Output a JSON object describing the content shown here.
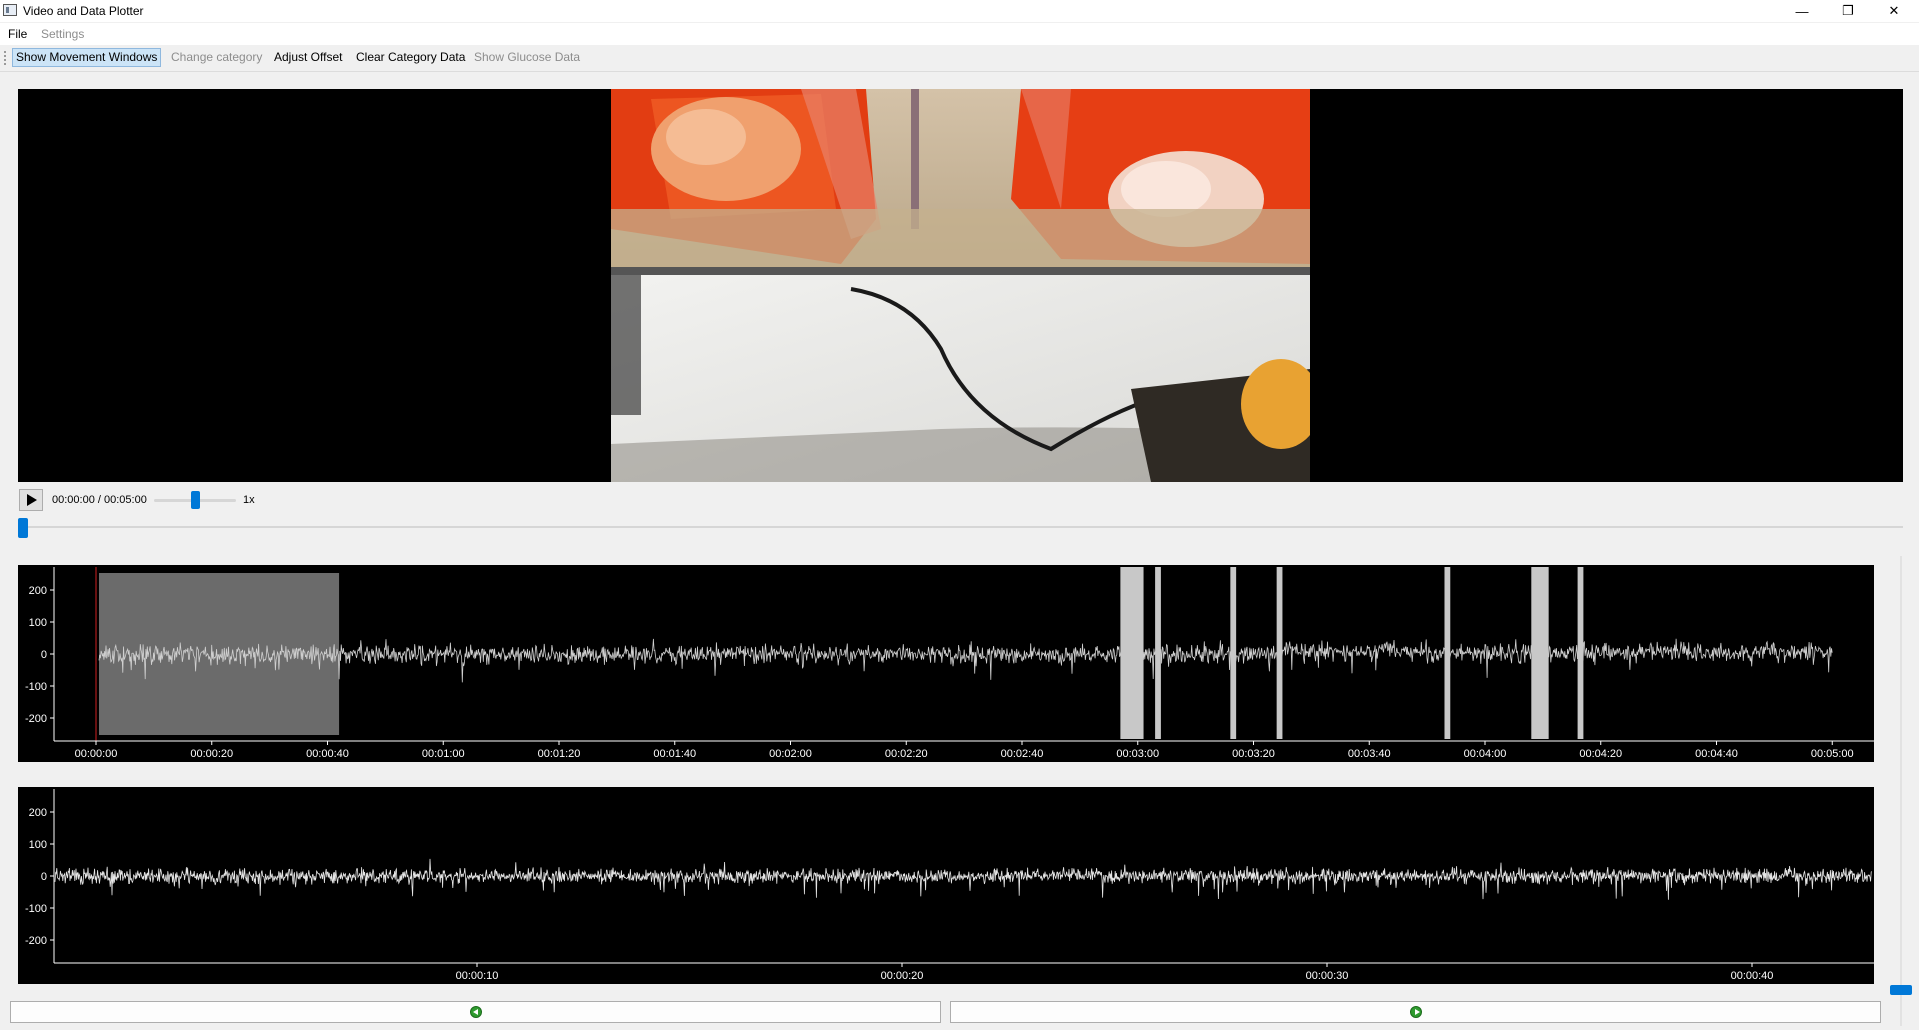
{
  "window": {
    "title": "Video and Data Plotter",
    "minimize": "—",
    "maximize": "❐",
    "close": "✕"
  },
  "menu": {
    "items": [
      {
        "label": "File",
        "enabled": true
      },
      {
        "label": "Settings",
        "enabled": false
      }
    ]
  },
  "toolbar": {
    "buttons": [
      {
        "label": "Show Movement Windows",
        "state": "checked"
      },
      {
        "label": "Change category",
        "state": "disabled"
      },
      {
        "label": "Adjust Offset",
        "state": "enabled"
      },
      {
        "label": "Clear Category Data",
        "state": "enabled"
      },
      {
        "label": "Show Glucose Data",
        "state": "disabled"
      }
    ]
  },
  "player": {
    "time": "00:00:00 / 00:05:00",
    "speed": "1x",
    "speed_level": 0.5,
    "seek_position": 0.0,
    "play_icon": "play-icon"
  },
  "plots": {
    "overview": {
      "y_ticks": [
        "200",
        "100",
        "0",
        "-100",
        "-200"
      ],
      "x_ticks": [
        "00:00:00",
        "00:00:20",
        "00:00:40",
        "00:01:00",
        "00:01:20",
        "00:01:40",
        "00:02:00",
        "00:02:20",
        "00:02:40",
        "00:03:00",
        "00:03:20",
        "00:03:40",
        "00:04:00",
        "00:04:20",
        "00:04:40",
        "00:05:00"
      ],
      "highlight_window": [
        "00:00:00",
        "00:00:42"
      ]
    },
    "detail": {
      "y_ticks": [
        "200",
        "100",
        "0",
        "-100",
        "-200"
      ],
      "x_ticks": [
        "00:00:10",
        "00:00:20",
        "00:00:30",
        "00:00:40"
      ]
    }
  },
  "navigation": {
    "prev_icon": "arrow-left-icon",
    "next_icon": "arrow-right-icon"
  }
}
